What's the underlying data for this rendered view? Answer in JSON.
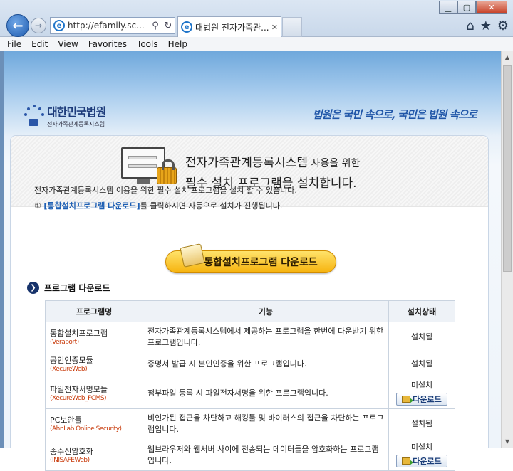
{
  "browser": {
    "address": "http://efamily.sc...",
    "tab_title": "대법원 전자가족관...",
    "menu": [
      "File",
      "Edit",
      "View",
      "Favorites",
      "Tools",
      "Help"
    ]
  },
  "header": {
    "logo_title": "대한민국법원",
    "logo_subtitle": "전자가족관계등록시스템",
    "slogan": "법원은 국민 속으로, 국민은 법원 속으로"
  },
  "banner": {
    "line1_main": "전자가족관계등록시스템",
    "line1_tail": " 사용을 위한",
    "line2": "필수 설치 프로그램을 설치합니다."
  },
  "intro": {
    "line1": "전자가족관계등록시스템 이용을 위한 필수 설치 프로그램을 설치 할 수 있습니다.",
    "bullet": "①",
    "link_text": "[통합설치프로그램 다운로드]",
    "line2_tail": "를 클릭하시면 자동으로 설치가 진행됩니다."
  },
  "main_download_label": "통합설치프로그램 다운로드",
  "section_title": "프로그램 다운로드",
  "table": {
    "headers": [
      "프로그램명",
      "기능",
      "설치상태"
    ],
    "rows": [
      {
        "name": "통합설치프로그램",
        "code": "(Veraport)",
        "desc": "전자가족관계등록시스템에서 제공하는 프로그램을 한번에 다운받기 위한 프로그램입니다.",
        "status": "설치됨",
        "button": ""
      },
      {
        "name": "공인인증모듈",
        "code": "(XecureWeb)",
        "desc": "증명서 발급 시 본인인증을 위한 프로그램입니다.",
        "status": "설치됨",
        "button": ""
      },
      {
        "name": "파일전자서명모듈",
        "code": "(XecureWeb_FCMS)",
        "desc": "첨부파일 등록 시 파일전자서명을 위한 프로그램입니다.",
        "status": "미설치",
        "button": "다운로드"
      },
      {
        "name": "PC보안툴",
        "code": "(AhnLab Online Security)",
        "desc": "비인가된 접근을 차단하고 해킹툴 및 바이러스의 접근을 차단하는 프로그램입니다.",
        "status": "설치됨",
        "button": ""
      },
      {
        "name": "송수신암호화",
        "code": "(INISAFEWeb)",
        "desc": "웹브라우저와 웹서버 사이에 전송되는 데이터들을 암호화하는 프로그램입니다.",
        "status": "미설치",
        "button": "다운로드"
      }
    ]
  },
  "colors": {
    "accent": "#1d5fb4",
    "download_button": "#f6b30e",
    "product_code": "#c83a0a"
  }
}
